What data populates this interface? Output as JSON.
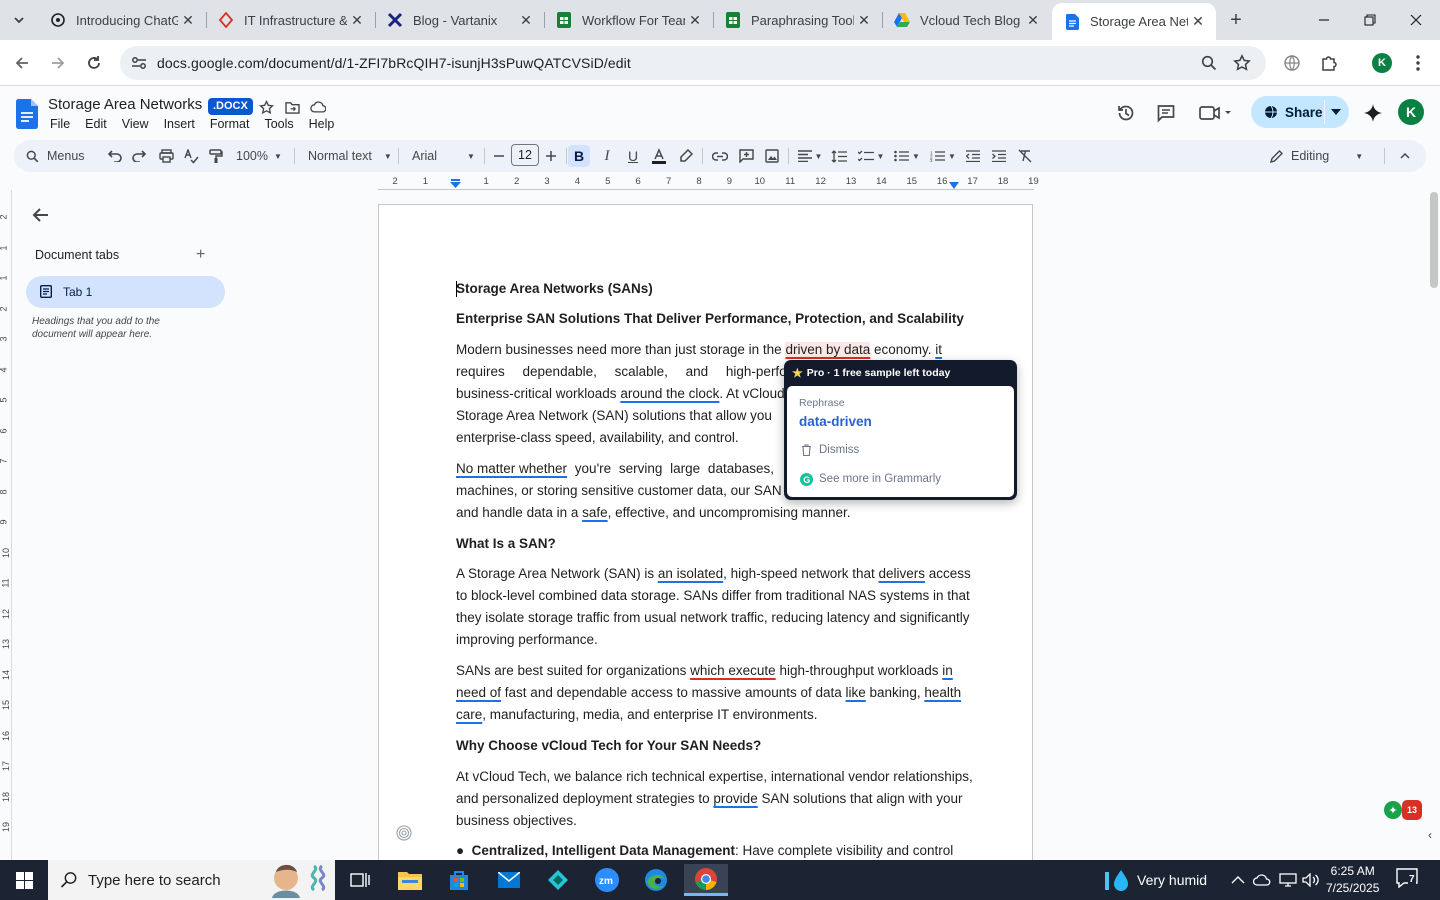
{
  "browser": {
    "tabs": [
      {
        "title": "Introducing ChatGPT",
        "icon": "chatgpt-icon"
      },
      {
        "title": "IT Infrastructure & ...",
        "icon": "it-infra-icon"
      },
      {
        "title": "Blog - Vartanix",
        "icon": "vartanix-icon"
      },
      {
        "title": "Workflow For Teams",
        "icon": "sheets-icon"
      },
      {
        "title": "Paraphrasing Tool",
        "icon": "sheets-icon"
      },
      {
        "title": "Vcloud Tech Blog",
        "icon": "drive-icon"
      },
      {
        "title": "Storage Area Networks",
        "icon": "docs-icon"
      }
    ],
    "url": "docs.google.com/document/d/1-ZFI7bRcQIH7-isunjH3sPuwQATCVSiD/edit"
  },
  "docs": {
    "title": "Storage Area Networks",
    "badge": ".DOCX",
    "menu": [
      "File",
      "Edit",
      "View",
      "Insert",
      "Format",
      "Tools",
      "Help"
    ],
    "share_label": "Share",
    "avatar_letter": "K",
    "toolbar": {
      "menus_label": "Menus",
      "zoom": "100%",
      "style": "Normal text",
      "font": "Arial",
      "font_size": "12",
      "mode": "Editing"
    },
    "ruler_numbers": [
      "2",
      "1",
      "",
      "1",
      "2",
      "3",
      "4",
      "5",
      "6",
      "7",
      "8",
      "9",
      "10",
      "11",
      "12",
      "13",
      "14",
      "15",
      "16",
      "17",
      "18",
      "19"
    ],
    "vruler_numbers": [
      "2",
      "1",
      "1",
      "2",
      "3",
      "4",
      "5",
      "6",
      "7",
      "8",
      "9",
      "10",
      "11",
      "12",
      "13",
      "14",
      "15",
      "16",
      "17",
      "18",
      "19"
    ]
  },
  "sidebar": {
    "title": "Document tabs",
    "tab_label": "Tab 1",
    "hint": "Headings that you add to the document will appear here."
  },
  "document": {
    "h1": "Storage Area Networks (SANs)",
    "h2": "Enterprise SAN Solutions That Deliver Performance, Protection, and Scalability",
    "p1": [
      "Modern businesses need more than just storage in the ",
      "driven by data",
      " economy. ",
      "it",
      " requires dependable, scalable, and high-performa",
      "business-critical workloads ",
      "around the clock",
      ". At vCloud",
      "Storage Area Network (SAN) solutions that allow you",
      "enterprise-class speed, availability, and control."
    ],
    "p2": [
      "No matter whether",
      " you're serving large databases,",
      "machines, or storing sensitive customer data, our SAN c",
      "and handle data in a ",
      "safe",
      ", effective, and uncompromising manner."
    ],
    "h3": "What Is a SAN?",
    "p3": [
      "A Storage Area Network (SAN) is ",
      "an isolated",
      ", high-speed network that ",
      "delivers",
      " access",
      "to block-level combined data storage. SANs differ from traditional NAS systems in that",
      "they isolate storage traffic from usual network traffic, reducing latency and significantly",
      "improving performance."
    ],
    "p4": [
      "SANs are best suited for organizations ",
      "which execute",
      " high-throughput workloads ",
      "in",
      "need of",
      " fast and dependable access to massive amounts of data ",
      "like",
      " banking, ",
      "health",
      "care",
      ", manufacturing, media, and enterprise IT environments."
    ],
    "h4": "Why Choose vCloud Tech for Your SAN Needs?",
    "p5": [
      "At vCloud Tech, we balance rich technical expertise, international vendor relationships,",
      "and personalized deployment strategies to ",
      "provide",
      " SAN solutions that align with your",
      "business objectives."
    ],
    "bullet_bold": "Centralized, Intelligent Data Management",
    "bullet_rest": ": Have complete visibility and control"
  },
  "grammarly": {
    "header": "Pro · 1 free sample left today",
    "label": "Rephrase",
    "suggestion": "data-driven",
    "dismiss": "Dismiss",
    "more": "See more in Grammarly",
    "badge_count": "13"
  },
  "taskbar": {
    "search_placeholder": "Type here to search",
    "weather": "Very humid",
    "time": "6:25 AM",
    "date": "7/25/2025",
    "notif_count": "7"
  }
}
